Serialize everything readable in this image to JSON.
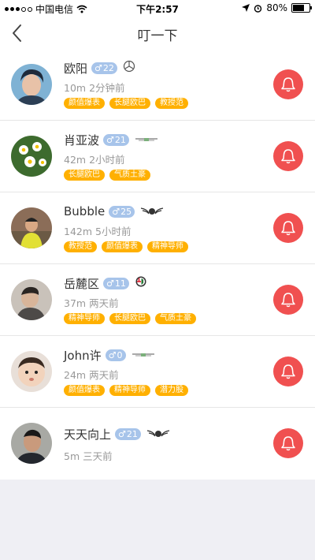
{
  "status_bar": {
    "carrier": "中国电信",
    "time": "下午2:57",
    "battery": "80%",
    "battery_level": 0.8
  },
  "nav": {
    "title": "叮一下",
    "back_icon": "chevron-left-icon"
  },
  "users": [
    {
      "name": "欧阳",
      "gender": "♂",
      "age": "22",
      "car": "mercedes-logo-icon",
      "distance": "10m",
      "time": "2分钟前",
      "tags": [
        "颜值爆表",
        "长腿欧巴",
        "教授范"
      ]
    },
    {
      "name": "肖亚波",
      "gender": "♂",
      "age": "21",
      "car": "winged-logo-icon",
      "distance": "42m",
      "time": "2小时前",
      "tags": [
        "长腿欧巴",
        "气质土豪"
      ]
    },
    {
      "name": "Bubble",
      "gender": "♂",
      "age": "25",
      "car": "bentley-logo-icon",
      "distance": "142m",
      "time": "5小时前",
      "tags": [
        "教授范",
        "颜值爆表",
        "精神导师"
      ]
    },
    {
      "name": "岳麓区",
      "gender": "♂",
      "age": "11",
      "car": "alfa-romeo-logo-icon",
      "distance": "37m",
      "time": "两天前",
      "tags": [
        "精神导师",
        "长腿欧巴",
        "气质土豪"
      ]
    },
    {
      "name": "John许",
      "gender": "♂",
      "age": "0",
      "car": "winged-logo-icon",
      "distance": "24m",
      "time": "两天前",
      "tags": [
        "颜值爆表",
        "精神导师",
        "潜力股"
      ]
    },
    {
      "name": "天天向上",
      "gender": "♂",
      "age": "21",
      "car": "bentley-logo-icon",
      "distance": "5m",
      "time": "三天前",
      "tags": []
    }
  ],
  "colors": {
    "accent_red": "#f05050",
    "tag_orange": "#ffb000",
    "gender_blue": "#a7c4ea",
    "background": "#efeff4"
  }
}
